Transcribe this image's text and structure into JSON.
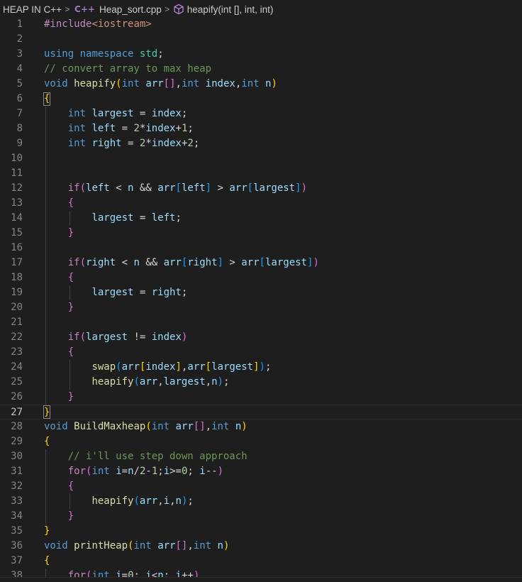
{
  "breadcrumb": {
    "folder": "HEAP IN C++",
    "file_icon_label": "C++",
    "file": "Heap_sort.cpp",
    "symbol": "heapify(int [], int, int)",
    "separator": ">"
  },
  "colors": {
    "background": "#1e1e1e",
    "keyword": "#569cd6",
    "control": "#c586c0",
    "function": "#dcdcaa",
    "variable": "#9cdcfe",
    "number": "#b5cea8",
    "comment": "#6a9955",
    "bracket_1": "#ffd700",
    "bracket_2": "#da70d6",
    "bracket_3": "#179fff"
  },
  "editor": {
    "current_line": 27,
    "lines": [
      {
        "n": "1",
        "indent": 0,
        "tokens": [
          [
            "pp",
            "#include"
          ],
          [
            "inc",
            "<iostream>"
          ]
        ]
      },
      {
        "n": "2",
        "indent": 0,
        "tokens": []
      },
      {
        "n": "3",
        "indent": 0,
        "tokens": [
          [
            "kw",
            "using"
          ],
          [
            "plain",
            " "
          ],
          [
            "kw",
            "namespace"
          ],
          [
            "plain",
            " "
          ],
          [
            "ns",
            "std"
          ],
          [
            "plain",
            ";"
          ]
        ]
      },
      {
        "n": "4",
        "indent": 0,
        "tokens": [
          [
            "cmt",
            "// convert array to max heap"
          ]
        ]
      },
      {
        "n": "5",
        "indent": 0,
        "tokens": [
          [
            "kw",
            "void"
          ],
          [
            "plain",
            " "
          ],
          [
            "fn",
            "heapify"
          ],
          [
            "b1",
            "("
          ],
          [
            "kw",
            "int"
          ],
          [
            "plain",
            " "
          ],
          [
            "var",
            "arr"
          ],
          [
            "b2",
            "[]"
          ],
          [
            "plain",
            ","
          ],
          [
            "kw",
            "int"
          ],
          [
            "plain",
            " "
          ],
          [
            "var",
            "index"
          ],
          [
            "plain",
            ","
          ],
          [
            "kw",
            "int"
          ],
          [
            "plain",
            " "
          ],
          [
            "var",
            "n"
          ],
          [
            "b1",
            ")"
          ]
        ]
      },
      {
        "n": "6",
        "indent": 0,
        "tokens": [
          [
            "b1",
            "{"
          ]
        ]
      },
      {
        "n": "7",
        "indent": 1,
        "tokens": [
          [
            "kw",
            "int"
          ],
          [
            "plain",
            " "
          ],
          [
            "var",
            "largest"
          ],
          [
            "plain",
            " = "
          ],
          [
            "var",
            "index"
          ],
          [
            "plain",
            ";"
          ]
        ]
      },
      {
        "n": "8",
        "indent": 1,
        "tokens": [
          [
            "kw",
            "int"
          ],
          [
            "plain",
            " "
          ],
          [
            "var",
            "left"
          ],
          [
            "plain",
            " = "
          ],
          [
            "num",
            "2"
          ],
          [
            "plain",
            "*"
          ],
          [
            "var",
            "index"
          ],
          [
            "plain",
            "+"
          ],
          [
            "num",
            "1"
          ],
          [
            "plain",
            ";"
          ]
        ]
      },
      {
        "n": "9",
        "indent": 1,
        "tokens": [
          [
            "kw",
            "int"
          ],
          [
            "plain",
            " "
          ],
          [
            "var",
            "right"
          ],
          [
            "plain",
            " = "
          ],
          [
            "num",
            "2"
          ],
          [
            "plain",
            "*"
          ],
          [
            "var",
            "index"
          ],
          [
            "plain",
            "+"
          ],
          [
            "num",
            "2"
          ],
          [
            "plain",
            ";"
          ]
        ]
      },
      {
        "n": "10",
        "indent": 0,
        "tokens": []
      },
      {
        "n": "11",
        "indent": 0,
        "tokens": []
      },
      {
        "n": "12",
        "indent": 1,
        "tokens": [
          [
            "ctl",
            "if"
          ],
          [
            "b2",
            "("
          ],
          [
            "var",
            "left"
          ],
          [
            "plain",
            " < "
          ],
          [
            "var",
            "n"
          ],
          [
            "plain",
            " && "
          ],
          [
            "var",
            "arr"
          ],
          [
            "b3",
            "["
          ],
          [
            "var",
            "left"
          ],
          [
            "b3",
            "]"
          ],
          [
            "plain",
            " > "
          ],
          [
            "var",
            "arr"
          ],
          [
            "b3",
            "["
          ],
          [
            "var",
            "largest"
          ],
          [
            "b3",
            "]"
          ],
          [
            "b2",
            ")"
          ]
        ]
      },
      {
        "n": "13",
        "indent": 1,
        "tokens": [
          [
            "b2",
            "{"
          ]
        ]
      },
      {
        "n": "14",
        "indent": 2,
        "tokens": [
          [
            "var",
            "largest"
          ],
          [
            "plain",
            " = "
          ],
          [
            "var",
            "left"
          ],
          [
            "plain",
            ";"
          ]
        ]
      },
      {
        "n": "15",
        "indent": 1,
        "tokens": [
          [
            "b2",
            "}"
          ]
        ]
      },
      {
        "n": "16",
        "indent": 0,
        "tokens": []
      },
      {
        "n": "17",
        "indent": 1,
        "tokens": [
          [
            "ctl",
            "if"
          ],
          [
            "b2",
            "("
          ],
          [
            "var",
            "right"
          ],
          [
            "plain",
            " < "
          ],
          [
            "var",
            "n"
          ],
          [
            "plain",
            " && "
          ],
          [
            "var",
            "arr"
          ],
          [
            "b3",
            "["
          ],
          [
            "var",
            "right"
          ],
          [
            "b3",
            "]"
          ],
          [
            "plain",
            " > "
          ],
          [
            "var",
            "arr"
          ],
          [
            "b3",
            "["
          ],
          [
            "var",
            "largest"
          ],
          [
            "b3",
            "]"
          ],
          [
            "b2",
            ")"
          ]
        ]
      },
      {
        "n": "18",
        "indent": 1,
        "tokens": [
          [
            "b2",
            "{"
          ]
        ]
      },
      {
        "n": "19",
        "indent": 2,
        "tokens": [
          [
            "var",
            "largest"
          ],
          [
            "plain",
            " = "
          ],
          [
            "var",
            "right"
          ],
          [
            "plain",
            ";"
          ]
        ]
      },
      {
        "n": "20",
        "indent": 1,
        "tokens": [
          [
            "b2",
            "}"
          ]
        ]
      },
      {
        "n": "21",
        "indent": 0,
        "tokens": []
      },
      {
        "n": "22",
        "indent": 1,
        "tokens": [
          [
            "ctl",
            "if"
          ],
          [
            "b2",
            "("
          ],
          [
            "var",
            "largest"
          ],
          [
            "plain",
            " != "
          ],
          [
            "var",
            "index"
          ],
          [
            "b2",
            ")"
          ]
        ]
      },
      {
        "n": "23",
        "indent": 1,
        "tokens": [
          [
            "b2",
            "{"
          ]
        ]
      },
      {
        "n": "24",
        "indent": 2,
        "tokens": [
          [
            "fn",
            "swap"
          ],
          [
            "b3",
            "("
          ],
          [
            "var",
            "arr"
          ],
          [
            "b1",
            "["
          ],
          [
            "var",
            "index"
          ],
          [
            "b1",
            "]"
          ],
          [
            "plain",
            ","
          ],
          [
            "var",
            "arr"
          ],
          [
            "b1",
            "["
          ],
          [
            "var",
            "largest"
          ],
          [
            "b1",
            "]"
          ],
          [
            "b3",
            ")"
          ],
          [
            "plain",
            ";"
          ]
        ]
      },
      {
        "n": "25",
        "indent": 2,
        "tokens": [
          [
            "fn",
            "heapify"
          ],
          [
            "b3",
            "("
          ],
          [
            "var",
            "arr"
          ],
          [
            "plain",
            ","
          ],
          [
            "var",
            "largest"
          ],
          [
            "plain",
            ","
          ],
          [
            "var",
            "n"
          ],
          [
            "b3",
            ")"
          ],
          [
            "plain",
            ";"
          ]
        ]
      },
      {
        "n": "26",
        "indent": 1,
        "tokens": [
          [
            "b2",
            "}"
          ]
        ]
      },
      {
        "n": "27",
        "indent": 0,
        "tokens": [
          [
            "b1",
            "}"
          ]
        ]
      },
      {
        "n": "28",
        "indent": 0,
        "tokens": [
          [
            "kw",
            "void"
          ],
          [
            "plain",
            " "
          ],
          [
            "fn",
            "BuildMaxheap"
          ],
          [
            "b1",
            "("
          ],
          [
            "kw",
            "int"
          ],
          [
            "plain",
            " "
          ],
          [
            "var",
            "arr"
          ],
          [
            "b2",
            "[]"
          ],
          [
            "plain",
            ","
          ],
          [
            "kw",
            "int"
          ],
          [
            "plain",
            " "
          ],
          [
            "var",
            "n"
          ],
          [
            "b1",
            ")"
          ]
        ]
      },
      {
        "n": "29",
        "indent": 0,
        "tokens": [
          [
            "b1",
            "{"
          ]
        ]
      },
      {
        "n": "30",
        "indent": 1,
        "tokens": [
          [
            "cmt",
            "// i'll use step down approach"
          ]
        ]
      },
      {
        "n": "31",
        "indent": 1,
        "tokens": [
          [
            "ctl",
            "for"
          ],
          [
            "b2",
            "("
          ],
          [
            "kw",
            "int"
          ],
          [
            "plain",
            " "
          ],
          [
            "var",
            "i"
          ],
          [
            "plain",
            "="
          ],
          [
            "var",
            "n"
          ],
          [
            "plain",
            "/"
          ],
          [
            "num",
            "2"
          ],
          [
            "plain",
            "-"
          ],
          [
            "num",
            "1"
          ],
          [
            "plain",
            ";"
          ],
          [
            "var",
            "i"
          ],
          [
            "plain",
            ">="
          ],
          [
            "num",
            "0"
          ],
          [
            "plain",
            "; "
          ],
          [
            "var",
            "i"
          ],
          [
            "plain",
            "--"
          ],
          [
            "b2",
            ")"
          ]
        ]
      },
      {
        "n": "32",
        "indent": 1,
        "tokens": [
          [
            "b2",
            "{"
          ]
        ]
      },
      {
        "n": "33",
        "indent": 2,
        "tokens": [
          [
            "fn",
            "heapify"
          ],
          [
            "b3",
            "("
          ],
          [
            "var",
            "arr"
          ],
          [
            "plain",
            ","
          ],
          [
            "var",
            "i"
          ],
          [
            "plain",
            ","
          ],
          [
            "var",
            "n"
          ],
          [
            "b3",
            ")"
          ],
          [
            "plain",
            ";"
          ]
        ]
      },
      {
        "n": "34",
        "indent": 1,
        "tokens": [
          [
            "b2",
            "}"
          ]
        ]
      },
      {
        "n": "35",
        "indent": 0,
        "tokens": [
          [
            "b1",
            "}"
          ]
        ]
      },
      {
        "n": "36",
        "indent": 0,
        "tokens": [
          [
            "kw",
            "void"
          ],
          [
            "plain",
            " "
          ],
          [
            "fn",
            "printHeap"
          ],
          [
            "b1",
            "("
          ],
          [
            "kw",
            "int"
          ],
          [
            "plain",
            " "
          ],
          [
            "var",
            "arr"
          ],
          [
            "b2",
            "[]"
          ],
          [
            "plain",
            ","
          ],
          [
            "kw",
            "int"
          ],
          [
            "plain",
            " "
          ],
          [
            "var",
            "n"
          ],
          [
            "b1",
            ")"
          ]
        ]
      },
      {
        "n": "37",
        "indent": 0,
        "tokens": [
          [
            "b1",
            "{"
          ]
        ]
      },
      {
        "n": "38",
        "indent": 1,
        "tokens": [
          [
            "ctl",
            "for"
          ],
          [
            "b2",
            "("
          ],
          [
            "kw",
            "int"
          ],
          [
            "plain",
            " "
          ],
          [
            "var",
            "i"
          ],
          [
            "plain",
            "="
          ],
          [
            "num",
            "0"
          ],
          [
            "plain",
            "; "
          ],
          [
            "var",
            "i"
          ],
          [
            "plain",
            "<"
          ],
          [
            "var",
            "n"
          ],
          [
            "plain",
            "; "
          ],
          [
            "var",
            "i"
          ],
          [
            "plain",
            "++"
          ],
          [
            "b2",
            ")"
          ]
        ]
      }
    ]
  }
}
